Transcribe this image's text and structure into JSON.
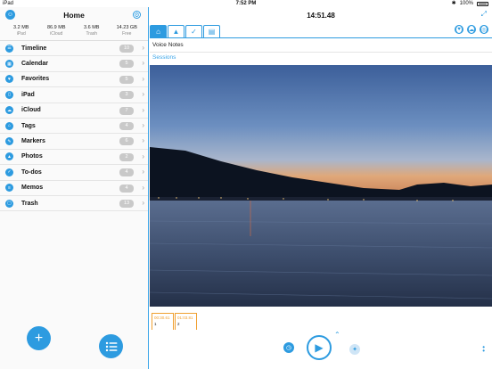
{
  "status_bar": {
    "device": "iPad",
    "time": "7:52 PM",
    "battery": "100%"
  },
  "sidebar": {
    "title": "Home",
    "storage": [
      {
        "value": "3.2 MB",
        "label": "iPad"
      },
      {
        "value": "86.9 MB",
        "label": "iCloud"
      },
      {
        "value": "3.6 MB",
        "label": "Trash"
      },
      {
        "value": "14.23 GB",
        "label": "Free"
      }
    ],
    "items": [
      {
        "label": "Timeline",
        "count": "10",
        "icon": "timeline-icon"
      },
      {
        "label": "Calendar",
        "count": "5",
        "icon": "calendar-icon"
      },
      {
        "label": "Favorites",
        "count": "5",
        "icon": "heart-icon"
      },
      {
        "label": "iPad",
        "count": "3",
        "icon": "ipad-icon"
      },
      {
        "label": "iCloud",
        "count": "7",
        "icon": "cloud-icon"
      },
      {
        "label": "Tags",
        "count": "4",
        "icon": "tag-icon"
      },
      {
        "label": "Markers",
        "count": "6",
        "icon": "marker-icon"
      },
      {
        "label": "Photos",
        "count": "2",
        "icon": "photo-icon"
      },
      {
        "label": "To-dos",
        "count": "4",
        "icon": "todo-icon"
      },
      {
        "label": "Memos",
        "count": "4",
        "icon": "memo-icon"
      },
      {
        "label": "Trash",
        "count": "13",
        "icon": "trash-icon"
      }
    ]
  },
  "main": {
    "clock": "14:51.48",
    "note_title": "Voice Notes",
    "sessions_label": "Sessions",
    "sessions": [
      {
        "time": "00:30.61",
        "number": "1"
      },
      {
        "time": "01:03.81",
        "number": "2"
      }
    ]
  },
  "colors": {
    "accent": "#2d9be0",
    "session": "#f0a030"
  }
}
